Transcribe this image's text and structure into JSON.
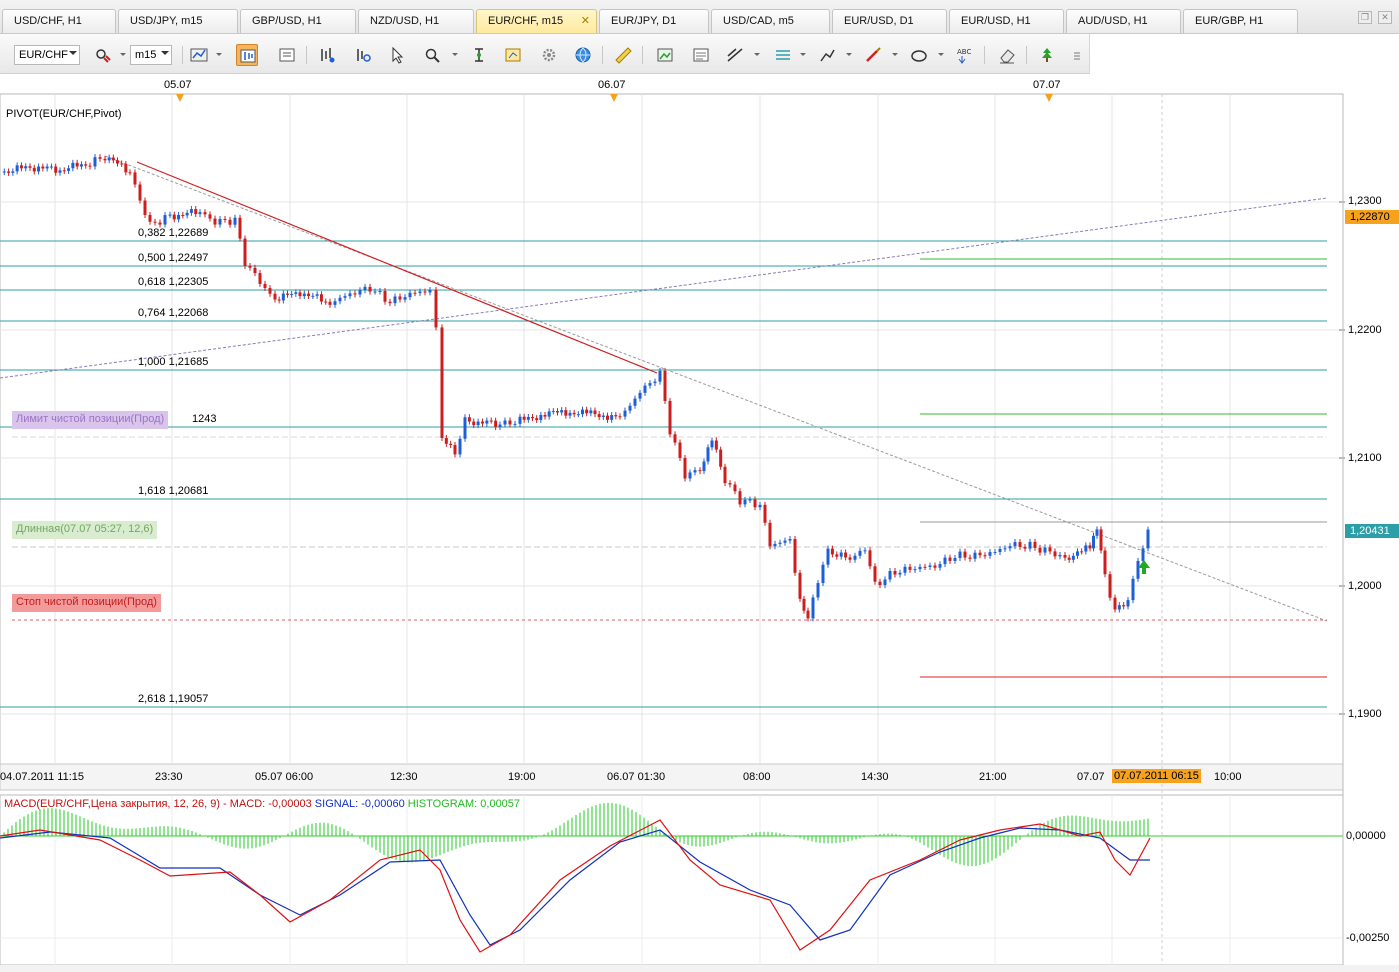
{
  "tabs": [
    {
      "label": "USD/CHF, H1",
      "active": false
    },
    {
      "label": "USD/JPY, m15",
      "active": false
    },
    {
      "label": "GBP/USD, H1",
      "active": false
    },
    {
      "label": "NZD/USD, H1",
      "active": false
    },
    {
      "label": "EUR/CHF, m15",
      "active": true
    },
    {
      "label": "EUR/JPY, D1",
      "active": false
    },
    {
      "label": "USD/CAD, m5",
      "active": false
    },
    {
      "label": "EUR/USD, D1",
      "active": false
    },
    {
      "label": "EUR/USD, H1",
      "active": false
    },
    {
      "label": "AUD/USD, H1",
      "active": false
    },
    {
      "label": "EUR/GBP, H1",
      "active": false
    }
  ],
  "toolbar": {
    "instrument": "EUR/CHF",
    "timeframe": "m15",
    "icons": [
      "chart-type-icon",
      "candles-icon",
      "bars-icon",
      "zoom-in-icon",
      "zoom-out-icon",
      "cursor-icon",
      "zoom-icon",
      "period-icon",
      "template-icon",
      "settings-icon",
      "globe-icon",
      "ruler-icon",
      "image-icon",
      "news-icon",
      "line-tool-icon",
      "indicator-icon",
      "pencil-icon",
      "brush-icon",
      "ellipse-icon",
      "text-tool-icon",
      "eraser-icon",
      "tree-icon",
      "more-icon"
    ]
  },
  "chart": {
    "indicator_label": "PIVOT(EUR/CHF,Pivot)",
    "top_dates": [
      "05.07",
      "06.07",
      "07.07"
    ],
    "price_axis": [
      "1,2300",
      "1,2200",
      "1,2100",
      "1,2000",
      "1,1900"
    ],
    "current_price": "1,22870",
    "bid_price": "1,20431",
    "time_axis": [
      "04.07.2011 11:15",
      "23:30",
      "05.07 06:00",
      "12:30",
      "19:00",
      "06.07 01:30",
      "08:00",
      "14:30",
      "21:00",
      "07.07",
      "10:00"
    ],
    "current_time": "07.07.2011 06:15",
    "fib_levels": [
      {
        "ratio": "0,382",
        "price": "1,22689"
      },
      {
        "ratio": "0,500",
        "price": "1,22497"
      },
      {
        "ratio": "0,618",
        "price": "1,22305"
      },
      {
        "ratio": "0,764",
        "price": "1,22068"
      },
      {
        "ratio": "1,000",
        "price": "1,21685"
      },
      {
        "ratio": "1,618",
        "price": "1,20681"
      },
      {
        "ratio": "2,618",
        "price": "1,19057"
      }
    ],
    "fib_partial_price": "1243",
    "tags": {
      "limit": "Лимит чистой позиции(Прод)",
      "long": "Длинная(07.07 05:27, 12,6)",
      "stop": "Стоп чистой позиции(Прод)"
    },
    "colors": {
      "bull": "#1f5fd6",
      "bear": "#cc1e1e",
      "fib": "#2a9fa8",
      "trend": "#d02020"
    }
  },
  "macd": {
    "label": "MACD(EUR/CHF,Цена закрытия, 12, 26, 9) -",
    "macd_value": "MACD: -0,00003",
    "signal_value": "SIGNAL: -0,00060",
    "histogram_value": "HISTOGRAM: 0,00057",
    "axis": [
      "0,00000",
      "-0,00250"
    ],
    "colors": {
      "macd": "#e01010",
      "signal": "#1030c0",
      "histogram": "#22cc22"
    }
  }
}
